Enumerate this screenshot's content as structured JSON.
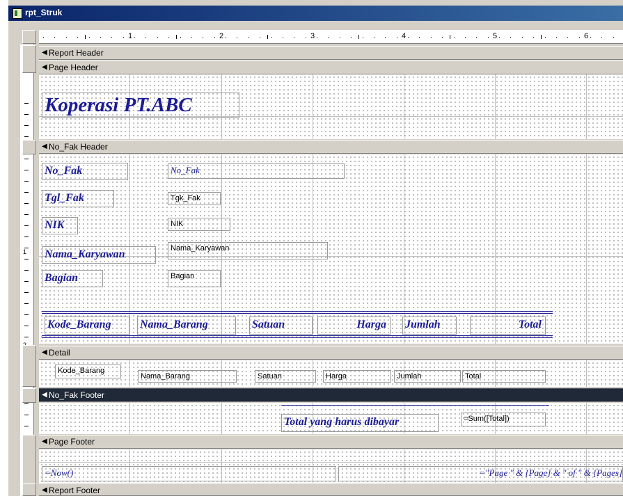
{
  "window": {
    "title": "rpt_Struk"
  },
  "ruler": {
    "numbers": [
      "1",
      "2",
      "3",
      "4",
      "5",
      "6"
    ],
    "vertical_numbers": [
      "1",
      "2"
    ]
  },
  "sections": {
    "report_header": "Report Header",
    "page_header": "Page Header",
    "group_header": "No_Fak Header",
    "detail": "Detail",
    "group_footer": "No_Fak Footer",
    "page_footer": "Page Footer",
    "report_footer": "Report Footer"
  },
  "page_header": {
    "title": "Koperasi PT.ABC"
  },
  "group_header": {
    "no_fak_label": "No_Fak",
    "no_fak_field": "No_Fak",
    "tgl_fak_label": "Tgl_Fak",
    "tgl_fak_field": "Tgk_Fak",
    "nik_label": "NIK",
    "nik_field": "NIK",
    "nama_label": "Nama_Karyawan",
    "nama_field": "Nama_Karyawan",
    "bagian_label": "Bagian",
    "bagian_field": "Bagian",
    "columns": [
      "Kode_Barang",
      "Nama_Barang",
      "Satuan",
      "Harga",
      "Jumlah",
      "Total"
    ]
  },
  "detail": {
    "fields": [
      "Kode_Barang",
      "Nama_Barang",
      "Satuan",
      "Harga",
      "Jumlah",
      "Total"
    ]
  },
  "group_footer": {
    "total_label": "Total yang harus dibayar",
    "total_field": "=Sum([Total])"
  },
  "page_footer": {
    "date_field": "=Now()",
    "page_field": "=\"Page \" & [Page] & \" of \" & [Pages]"
  },
  "colors": {
    "label_text": "#1b1b96",
    "selected_band": "#1f2937",
    "title_bar": "#0a246a",
    "dialog_face": "#d4d0c8"
  }
}
